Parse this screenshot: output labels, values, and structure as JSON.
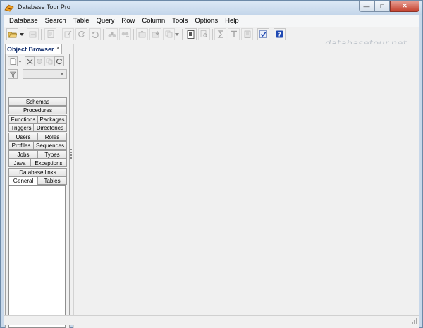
{
  "window": {
    "title": "Database Tour Pro",
    "minimize_glyph": "—",
    "maximize_glyph": "□",
    "close_glyph": "✕"
  },
  "menu": [
    "Database",
    "Search",
    "Table",
    "Query",
    "Row",
    "Column",
    "Tools",
    "Options",
    "Help"
  ],
  "toolbar": {
    "watermark": "databasetour.net"
  },
  "object_browser": {
    "tab_label": "Object Browser",
    "close_glyph": "×",
    "tab_rows": [
      [
        "Schemas"
      ],
      [
        "Procedures"
      ],
      [
        "Functions",
        "Packages"
      ],
      [
        "Triggers",
        "Directories"
      ],
      [
        "Users",
        "Roles"
      ],
      [
        "Profiles",
        "Sequences"
      ],
      [
        "Jobs",
        "Types"
      ],
      [
        "Java",
        "Exceptions"
      ],
      [
        "Database links"
      ]
    ],
    "bottom_tabs": [
      "General",
      "Tables"
    ]
  },
  "colors": {
    "accent": "#0d2a6b",
    "frame": "#c8d8ea"
  }
}
